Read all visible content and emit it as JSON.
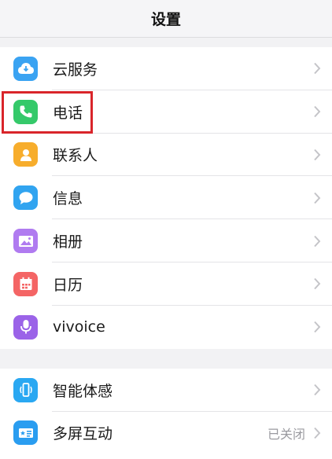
{
  "header": {
    "title": "设置"
  },
  "group1": [
    {
      "label": "云服务",
      "icon": "cloud-icon",
      "color": "#3aa3f2"
    },
    {
      "label": "电话",
      "icon": "phone-icon",
      "color": "#35c96a"
    },
    {
      "label": "联系人",
      "icon": "contact-icon",
      "color": "#f7ad2c"
    },
    {
      "label": "信息",
      "icon": "message-icon",
      "color": "#31a4f0"
    },
    {
      "label": "相册",
      "icon": "photo-icon",
      "color": "#b07bf0"
    },
    {
      "label": "日历",
      "icon": "calendar-icon",
      "color": "#f46565"
    },
    {
      "label": "vivoice",
      "icon": "microphone-icon",
      "color": "#9b63e8"
    }
  ],
  "group2": [
    {
      "label": "智能体感",
      "icon": "smart-motion-icon",
      "color": "#2aa8f2"
    },
    {
      "label": "多屏互动",
      "icon": "multi-screen-icon",
      "color": "#2a9df0",
      "value": "已关闭"
    }
  ],
  "highlight_color": "#d9252a"
}
